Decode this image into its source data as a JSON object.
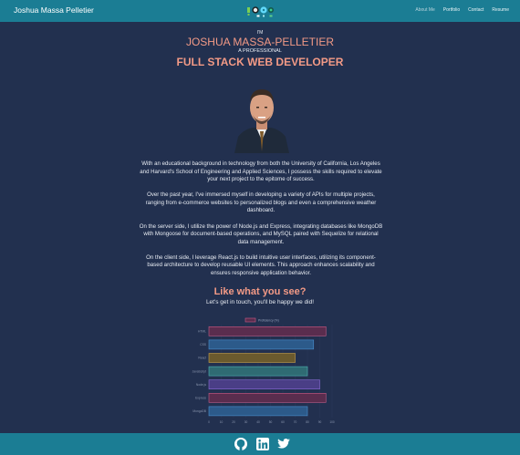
{
  "navbar": {
    "brand": "Joshua Massa Pelletier",
    "links": [
      {
        "label": "About Me",
        "active": true
      },
      {
        "label": "Portfolio",
        "active": false
      },
      {
        "label": "Contact",
        "active": false
      },
      {
        "label": "Resume",
        "active": false
      }
    ],
    "logo_icons": [
      "node-icon",
      "github-cat-icon",
      "react-icon",
      "mongodb-icon",
      "star-icon"
    ]
  },
  "hero": {
    "intro": "I'M",
    "name": "JOSHUA MASSA-PELLETIER",
    "qualifier": "A PROFESSIONAL",
    "title": "FULL STACK WEB DEVELOPER"
  },
  "about": {
    "paragraphs": [
      "With an educational background in technology from both the University of California, Los Angeles and Harvard's School of Engineering and Applied Sciences, I possess the skills required to elevate your next project to the epitome of success.",
      "Over the past year, I've immersed myself in developing a variety of APIs for multiple projects, ranging from e-commerce websites to personalized blogs and even a comprehensive weather dashboard.",
      "On the server side, I utilize the power of Node.js and Express, integrating databases like MongoDB with Mongoose for document-based operations, and MySQL paired with Sequelize for relational data management.",
      "On the client side, I leverage React.js to build intuitive user interfaces, utilizing its component-based architecture to develop reusable UI elements. This approach enhances scalability and ensures responsive application behavior."
    ]
  },
  "cta": {
    "title": "Like what you see?",
    "subtitle": "Let's get in touch, you'll be happy we did!"
  },
  "chart_data": {
    "type": "bar",
    "orientation": "horizontal",
    "categories": [
      "HTML",
      "CSS",
      "React",
      "JavaScript",
      "Node.js",
      "Express",
      "MongoDB"
    ],
    "series": [
      {
        "name": "Proficiency (%)",
        "values": [
          95,
          85,
          70,
          80,
          90,
          95,
          80
        ]
      }
    ],
    "bar_colors": [
      "#5a2d4e",
      "#2c5a8a",
      "#6b5a2e",
      "#2f6b73",
      "#4a3e86",
      "#5a2d4e",
      "#2c5a8a"
    ],
    "bar_border_colors": [
      "#c75b86",
      "#4a8fd0",
      "#c9a14b",
      "#4fb3b3",
      "#8a6bd6",
      "#c75b86",
      "#4a8fd0"
    ],
    "x_ticks": [
      "0",
      "10",
      "20",
      "30",
      "40",
      "50",
      "60",
      "70",
      "80",
      "90",
      "100"
    ],
    "xlim": [
      0,
      100
    ],
    "legend_position": "top"
  },
  "footer": {
    "icons": [
      "github-icon",
      "linkedin-icon",
      "twitter-icon"
    ]
  }
}
